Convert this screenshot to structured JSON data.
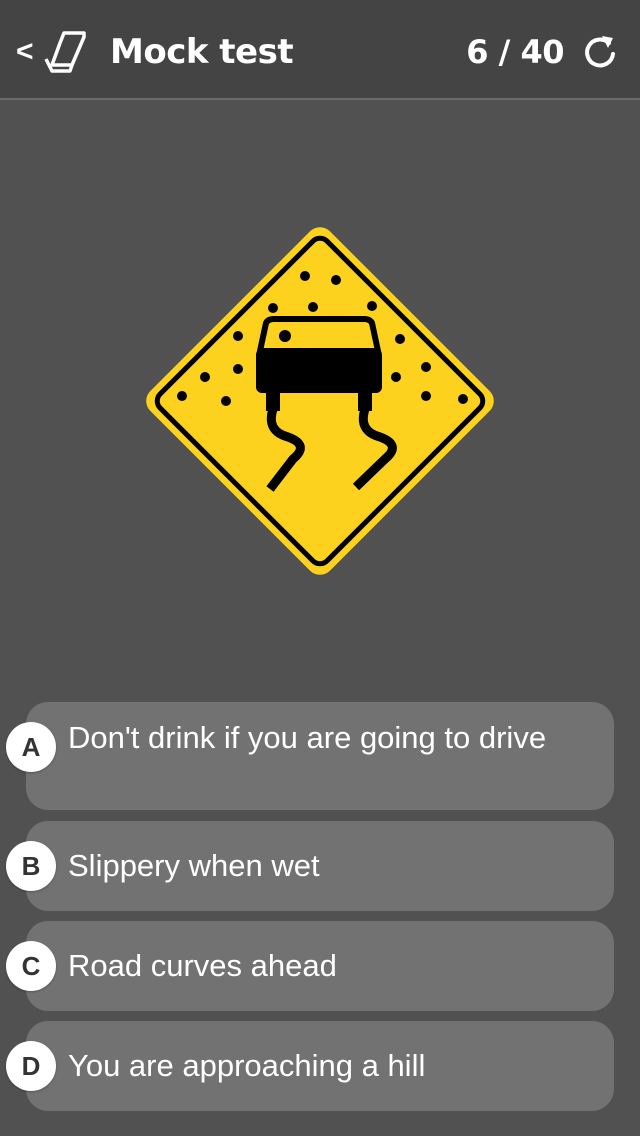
{
  "header": {
    "back_label": "<",
    "title": "Mock test",
    "progress": "6 / 40"
  },
  "icons": {
    "back": "back-chevron-icon",
    "notepad": "notepad-icon",
    "restart": "restart-icon"
  },
  "question": {
    "image": "slippery-when-wet-sign"
  },
  "answers": [
    {
      "letter": "A",
      "text": "Don't drink if you are going to drive"
    },
    {
      "letter": "B",
      "text": "Slippery when wet"
    },
    {
      "letter": "C",
      "text": "Road curves ahead"
    },
    {
      "letter": "D",
      "text": "You are approaching a hill"
    }
  ],
  "colors": {
    "background": "#515151",
    "header": "#444444",
    "answer_bg": "#727272",
    "sign_yellow": "#fdd21e"
  }
}
